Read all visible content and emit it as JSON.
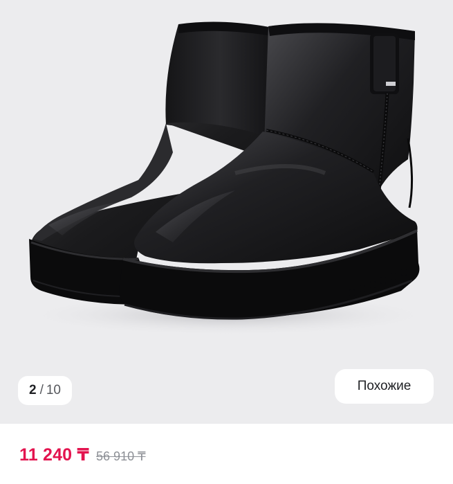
{
  "gallery": {
    "image_alt": "black boots",
    "counter": {
      "current": "2",
      "separator": "/",
      "total": "10"
    },
    "similar_label": "Похожие",
    "background_color": "#ececee"
  },
  "price": {
    "current": "11 240 ₸",
    "old": "56 910 ₸",
    "accent_color": "#e3144f"
  }
}
